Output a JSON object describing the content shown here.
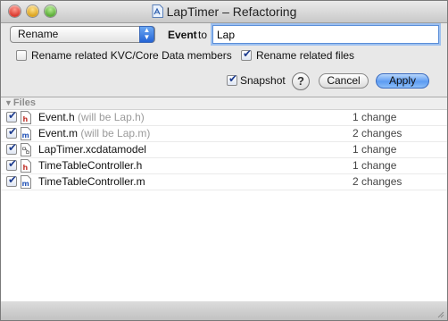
{
  "window": {
    "title": "LapTimer – Refactoring"
  },
  "toolbar": {
    "operation": "Rename",
    "event_label": "Event",
    "to_label": "to",
    "new_name_value": "Lap",
    "opt_kvc_label": "Rename related KVC/Core Data members",
    "opt_kvc_checked": false,
    "opt_files_label": "Rename related files",
    "opt_files_checked": true,
    "snapshot_label": "Snapshot",
    "snapshot_checked": true,
    "help_glyph": "?",
    "cancel_label": "Cancel",
    "apply_label": "Apply"
  },
  "files": {
    "header": "Files",
    "rows": [
      {
        "name": "Event.h",
        "hint": "(will be Lap.h)",
        "changes": "1 change",
        "icon": "header-file-icon",
        "checked": true
      },
      {
        "name": "Event.m",
        "hint": "(will be Lap.m)",
        "changes": "2 changes",
        "icon": "implementation-file-icon",
        "checked": true
      },
      {
        "name": "LapTimer.xcdatamodel",
        "hint": "",
        "changes": "1 change",
        "icon": "datamodel-file-icon",
        "checked": true
      },
      {
        "name": "TimeTableController.h",
        "hint": "",
        "changes": "1 change",
        "icon": "header-file-icon",
        "checked": true
      },
      {
        "name": "TimeTableController.m",
        "hint": "",
        "changes": "2 changes",
        "icon": "implementation-file-icon",
        "checked": true
      }
    ]
  },
  "colors": {
    "accent": "#5d9cf2",
    "header_icon_letter": "#c0322a",
    "impl_icon_letter": "#2b59b8"
  }
}
